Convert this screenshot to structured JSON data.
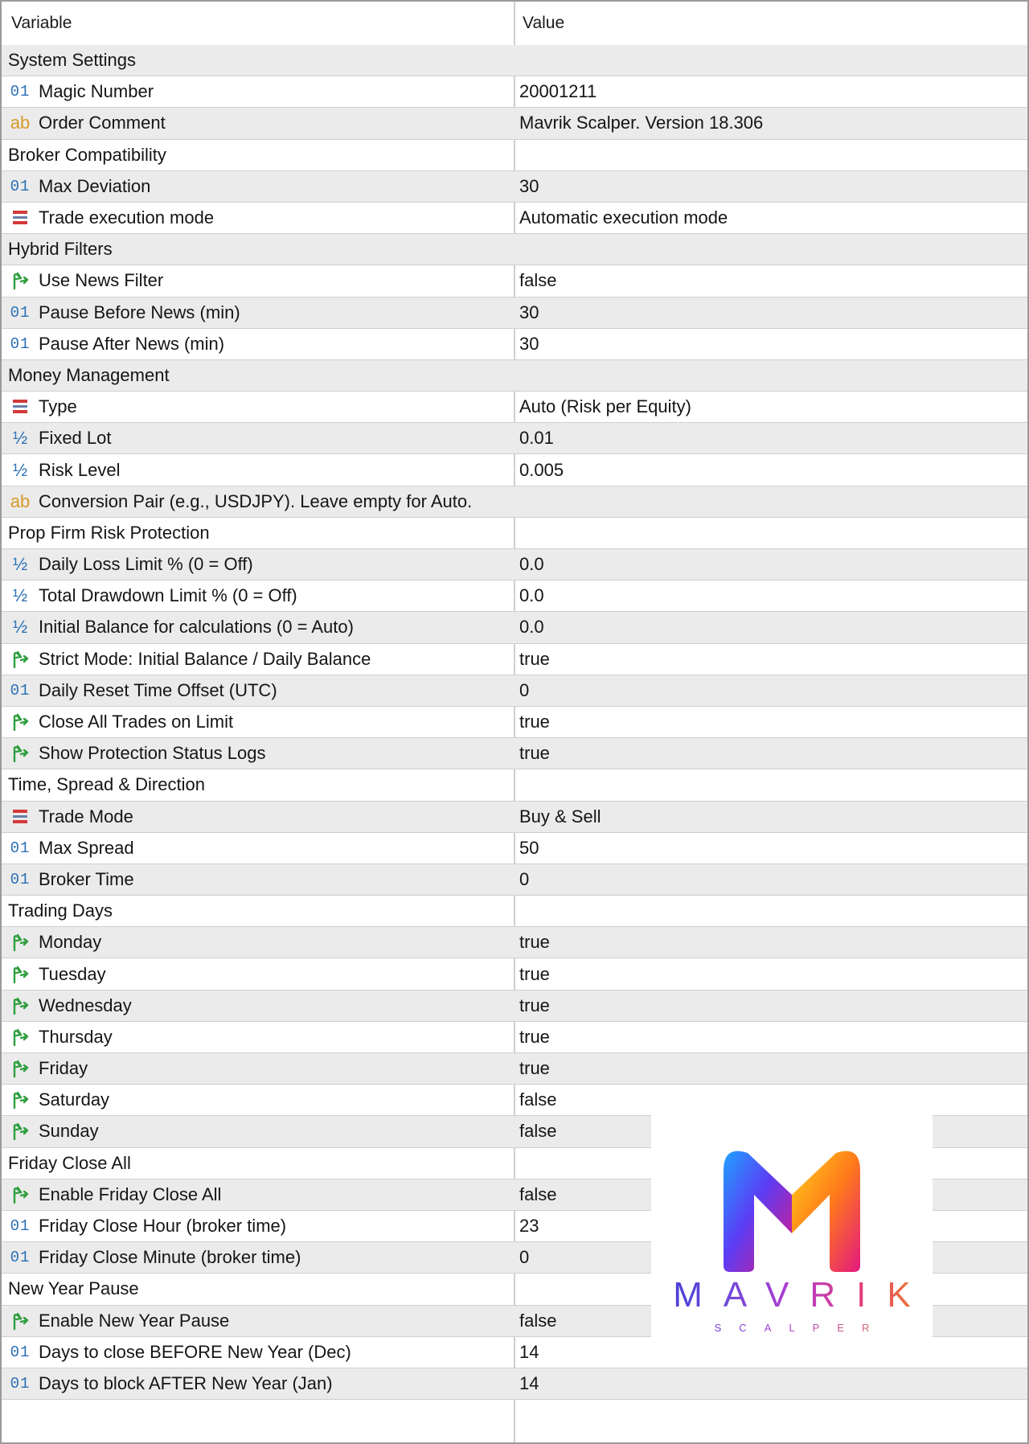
{
  "header": {
    "variable": "Variable",
    "value": "Value"
  },
  "rows": [
    {
      "kind": "section",
      "label": "System Settings",
      "value": ""
    },
    {
      "kind": "item",
      "icon": "int",
      "label": "Magic Number",
      "value": "20001211"
    },
    {
      "kind": "item",
      "icon": "string",
      "label": "Order Comment",
      "value": "Mavrik Scalper. Version 18.306"
    },
    {
      "kind": "section",
      "label": "Broker Compatibility",
      "value": ""
    },
    {
      "kind": "item",
      "icon": "int",
      "label": "Max Deviation",
      "value": "30"
    },
    {
      "kind": "item",
      "icon": "enum",
      "label": "Trade execution mode",
      "value": "Automatic execution mode"
    },
    {
      "kind": "section",
      "label": "Hybrid Filters",
      "value": ""
    },
    {
      "kind": "item",
      "icon": "bool",
      "label": "Use News Filter",
      "value": "false"
    },
    {
      "kind": "item",
      "icon": "int",
      "label": "Pause Before News (min)",
      "value": "30"
    },
    {
      "kind": "item",
      "icon": "int",
      "label": "Pause After News (min)",
      "value": "30"
    },
    {
      "kind": "section",
      "label": "Money Management",
      "value": ""
    },
    {
      "kind": "item",
      "icon": "enum",
      "label": "Type",
      "value": "Auto (Risk per Equity)"
    },
    {
      "kind": "item",
      "icon": "double",
      "label": "Fixed Lot",
      "value": "0.01"
    },
    {
      "kind": "item",
      "icon": "double",
      "label": "Risk Level",
      "value": "0.005"
    },
    {
      "kind": "item",
      "icon": "string",
      "label": "Conversion Pair (e.g., USDJPY). Leave empty for Auto.",
      "value": ""
    },
    {
      "kind": "section",
      "label": "Prop Firm Risk Protection",
      "value": ""
    },
    {
      "kind": "item",
      "icon": "double",
      "label": "Daily Loss Limit % (0 = Off)",
      "value": "0.0"
    },
    {
      "kind": "item",
      "icon": "double",
      "label": "Total Drawdown Limit % (0 = Off)",
      "value": "0.0"
    },
    {
      "kind": "item",
      "icon": "double",
      "label": "Initial Balance for calculations (0 = Auto)",
      "value": "0.0"
    },
    {
      "kind": "item",
      "icon": "bool",
      "label": "Strict Mode: Initial Balance / Daily Balance",
      "value": "true"
    },
    {
      "kind": "item",
      "icon": "int",
      "label": "Daily Reset Time Offset (UTC)",
      "value": "0"
    },
    {
      "kind": "item",
      "icon": "bool",
      "label": "Close All Trades on Limit",
      "value": "true"
    },
    {
      "kind": "item",
      "icon": "bool",
      "label": "Show Protection Status Logs",
      "value": "true"
    },
    {
      "kind": "section",
      "label": "Time, Spread & Direction",
      "value": ""
    },
    {
      "kind": "item",
      "icon": "enum",
      "label": "Trade Mode",
      "value": "Buy & Sell"
    },
    {
      "kind": "item",
      "icon": "int",
      "label": "Max Spread",
      "value": "50"
    },
    {
      "kind": "item",
      "icon": "int",
      "label": "Broker Time",
      "value": "0"
    },
    {
      "kind": "section",
      "label": "Trading Days",
      "value": ""
    },
    {
      "kind": "item",
      "icon": "bool",
      "label": "Monday",
      "value": "true"
    },
    {
      "kind": "item",
      "icon": "bool",
      "label": "Tuesday",
      "value": "true"
    },
    {
      "kind": "item",
      "icon": "bool",
      "label": "Wednesday",
      "value": "true"
    },
    {
      "kind": "item",
      "icon": "bool",
      "label": "Thursday",
      "value": "true"
    },
    {
      "kind": "item",
      "icon": "bool",
      "label": "Friday",
      "value": "true"
    },
    {
      "kind": "item",
      "icon": "bool",
      "label": "Saturday",
      "value": "false"
    },
    {
      "kind": "item",
      "icon": "bool",
      "label": "Sunday",
      "value": "false"
    },
    {
      "kind": "section",
      "label": "Friday Close All",
      "value": ""
    },
    {
      "kind": "item",
      "icon": "bool",
      "label": "Enable Friday Close All",
      "value": "false"
    },
    {
      "kind": "item",
      "icon": "int",
      "label": "Friday Close Hour (broker time)",
      "value": "23"
    },
    {
      "kind": "item",
      "icon": "int",
      "label": "Friday Close Minute (broker time)",
      "value": "0"
    },
    {
      "kind": "section",
      "label": "New Year Pause",
      "value": ""
    },
    {
      "kind": "item",
      "icon": "bool",
      "label": "Enable New Year Pause",
      "value": "false"
    },
    {
      "kind": "item",
      "icon": "int",
      "label": "Days to close BEFORE New Year (Dec)",
      "value": "14"
    },
    {
      "kind": "item",
      "icon": "int",
      "label": "Days to block AFTER New Year (Jan)",
      "value": "14"
    }
  ],
  "icon_glyphs": {
    "int": "01",
    "string": "ab",
    "double": "½"
  },
  "logo": {
    "name": "MAVRIK",
    "subtitle": "SCALPER"
  },
  "colors": {
    "row_alt": "#ebebeb",
    "int_icon": "#2a6fb5",
    "string_icon": "#d69a2a",
    "bool_icon": "#2e9e3e",
    "enum_icon": "#d23a3a"
  }
}
